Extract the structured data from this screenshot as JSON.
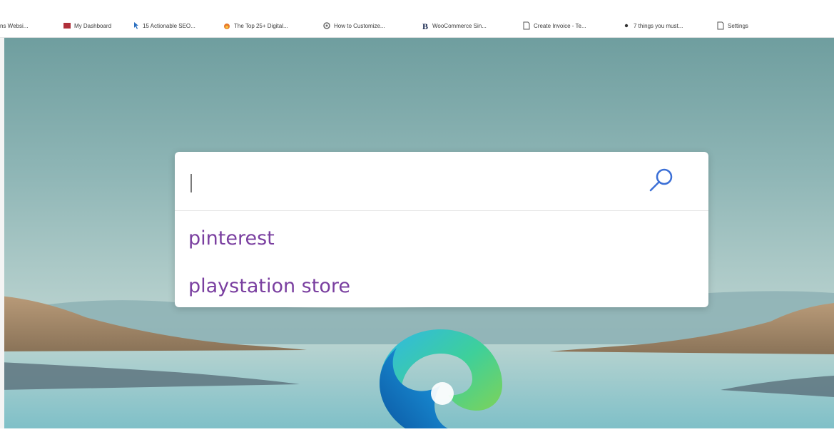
{
  "bookmarks_bar": {
    "items": [
      {
        "label": "ns Websi...",
        "icon": "blank-icon"
      },
      {
        "label": "My Dashboard",
        "icon": "dashboard-icon"
      },
      {
        "label": "15 Actionable SEO...",
        "icon": "pointer-icon"
      },
      {
        "label": "The Top 25+ Digital...",
        "icon": "flame-icon"
      },
      {
        "label": "How to Customize...",
        "icon": "gear-icon"
      },
      {
        "label": "WooCommerce Sin...",
        "icon": "b-icon"
      },
      {
        "label": "Create Invoice - Te...",
        "icon": "page-icon"
      },
      {
        "label": "7 things you must...",
        "icon": "dot-icon"
      },
      {
        "label": "Settings",
        "icon": "page-icon"
      }
    ]
  },
  "search": {
    "value": "",
    "suggestions": [
      "pinterest",
      "playstation store"
    ]
  },
  "colors": {
    "suggestion_text": "#7a3fa0",
    "sky": "#7aa8a8",
    "water": "#86c2c8"
  }
}
